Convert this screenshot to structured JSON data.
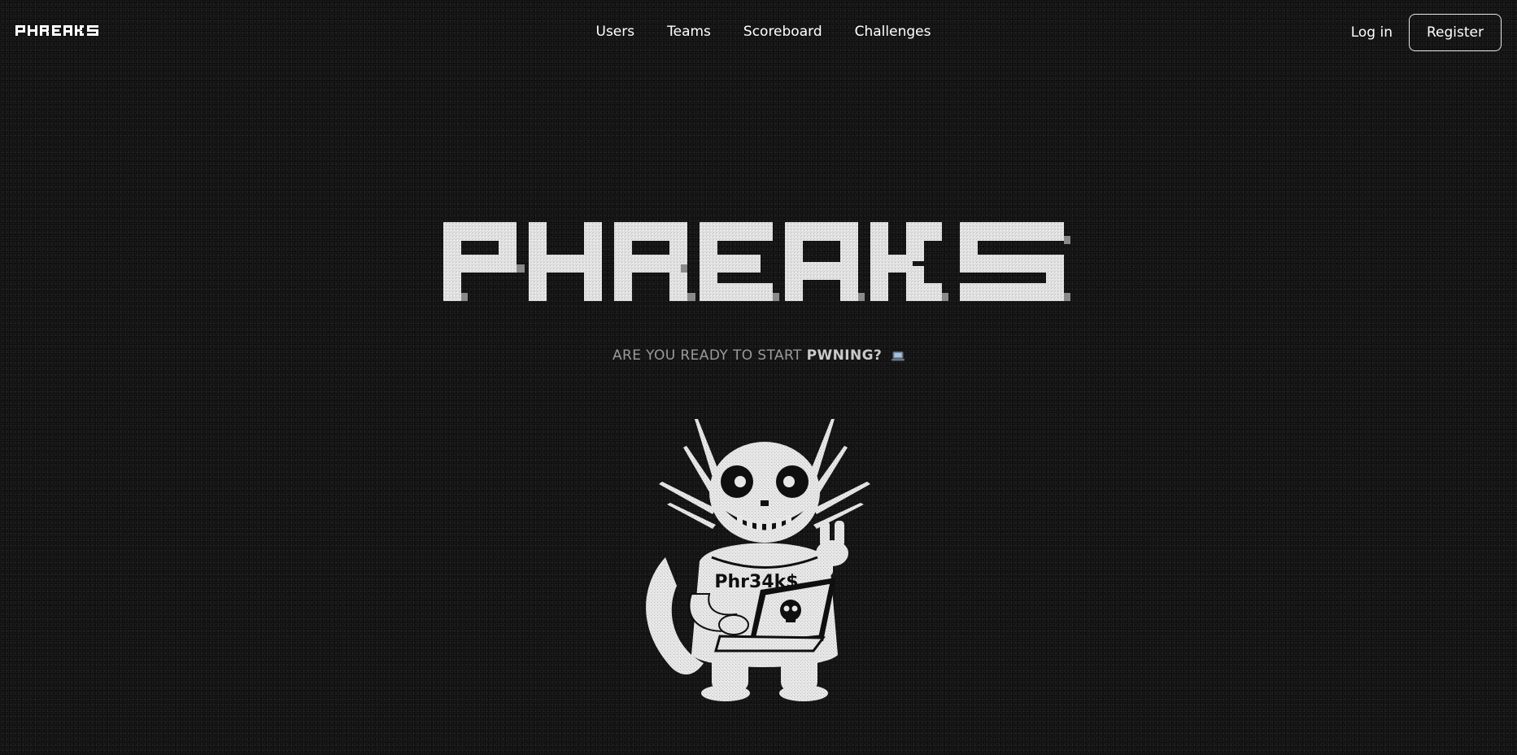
{
  "brand": {
    "logo_text": "PHREAKS"
  },
  "nav": {
    "links": [
      {
        "label": "Users"
      },
      {
        "label": "Teams"
      },
      {
        "label": "Scoreboard"
      },
      {
        "label": "Challenges"
      }
    ],
    "login_label": "Log in",
    "register_label": "Register"
  },
  "hero": {
    "logo_text": "PHREAKS",
    "tagline_prefix": "ARE YOU READY TO START",
    "tagline_emphasis": "PWNING?",
    "tagline_icon": "laptop-icon",
    "mascot_hoodie_text": "Phr34k$"
  },
  "colors": {
    "background": "#0d0d0d",
    "text": "#ffffff",
    "tagline": "#9a9a9a",
    "logo": "#e4e4e4"
  }
}
